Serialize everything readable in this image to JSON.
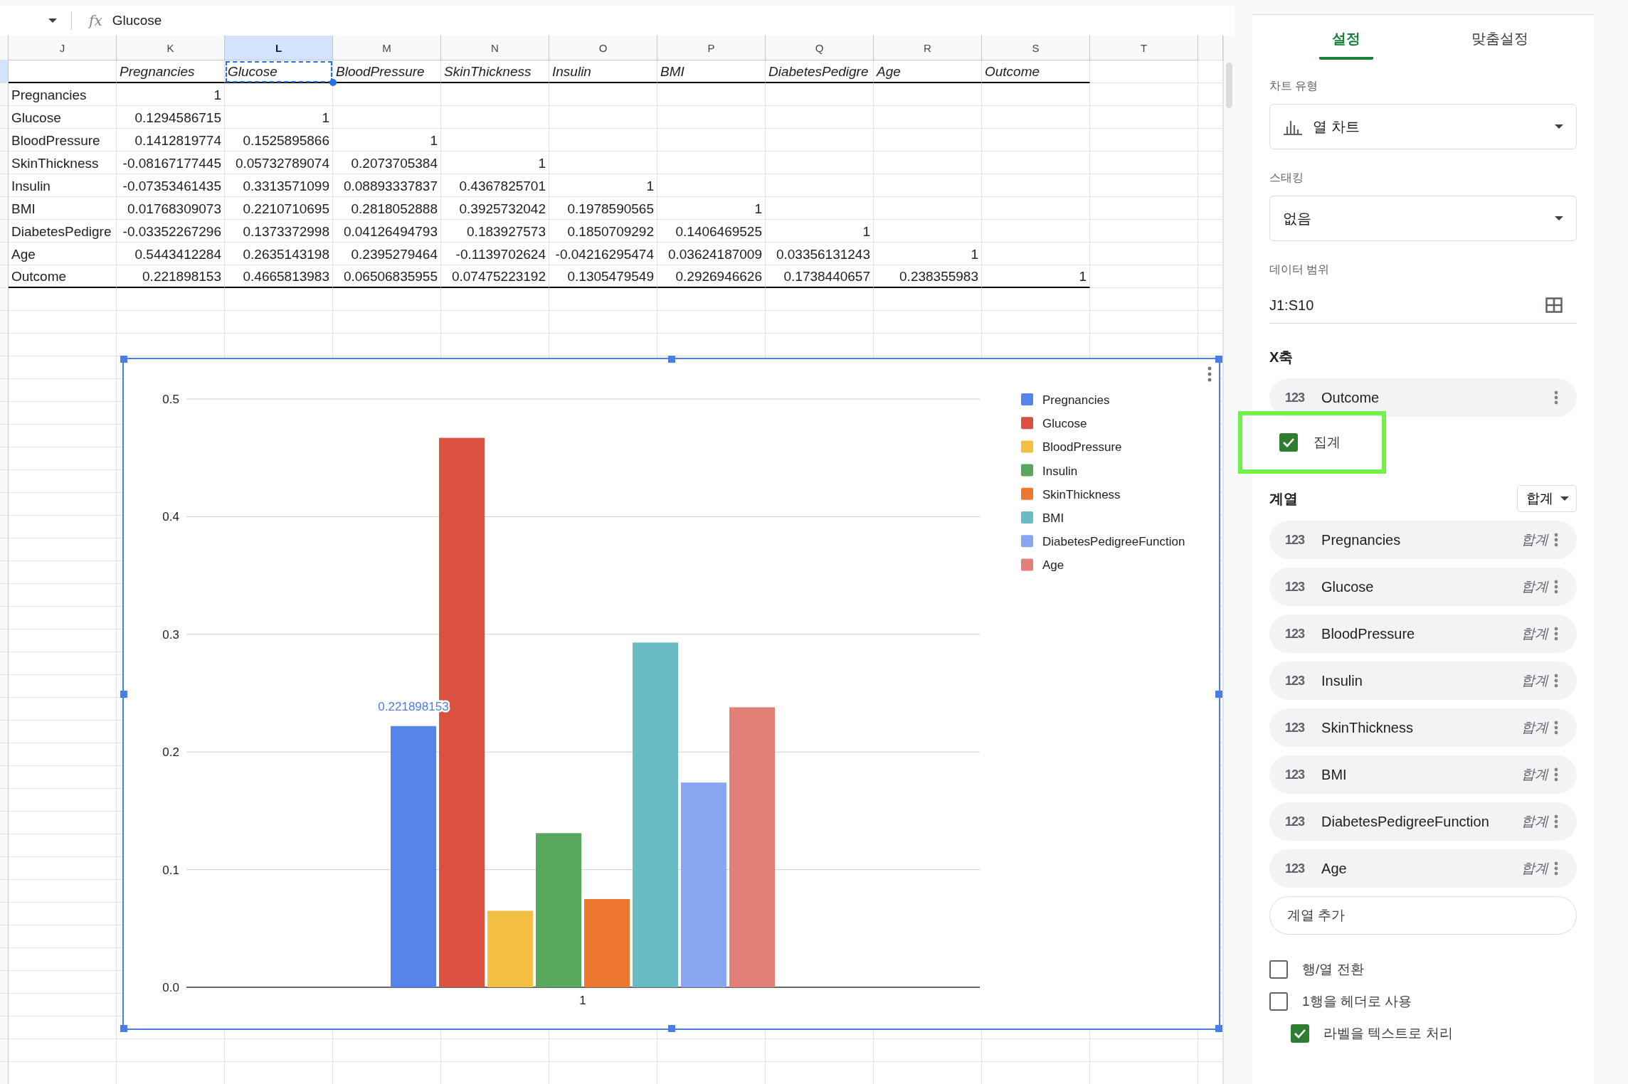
{
  "formula_bar": {
    "fx": "fx",
    "value": "Glucose"
  },
  "sheet": {
    "columns": [
      {
        "label": "J",
        "selected": false
      },
      {
        "label": "K",
        "selected": false
      },
      {
        "label": "L",
        "selected": true
      },
      {
        "label": "M",
        "selected": false
      },
      {
        "label": "N",
        "selected": false
      },
      {
        "label": "O",
        "selected": false
      },
      {
        "label": "P",
        "selected": false
      },
      {
        "label": "Q",
        "selected": false
      },
      {
        "label": "R",
        "selected": false
      },
      {
        "label": "S",
        "selected": false
      },
      {
        "label": "T",
        "selected": false
      }
    ],
    "header_row": [
      {
        "text": "Pregnancies",
        "selected": false
      },
      {
        "text": "Glucose",
        "selected": true
      },
      {
        "text": "BloodPressure",
        "selected": false
      },
      {
        "text": "SkinThickness",
        "selected": false
      },
      {
        "text": "Insulin",
        "selected": false
      },
      {
        "text": "BMI",
        "selected": false
      },
      {
        "text": "DiabetesPedigre",
        "selected": false
      },
      {
        "text": "Age",
        "selected": false
      },
      {
        "text": "Outcome",
        "selected": false
      }
    ],
    "rows": [
      {
        "label": "Pregnancies",
        "values": [
          "1"
        ]
      },
      {
        "label": "Glucose",
        "values": [
          "0.1294586715",
          "1"
        ]
      },
      {
        "label": "BloodPressure",
        "values": [
          "0.1412819774",
          "0.1525895866",
          "1"
        ]
      },
      {
        "label": "SkinThickness",
        "values": [
          "-0.08167177445",
          "0.05732789074",
          "0.2073705384",
          "1"
        ]
      },
      {
        "label": "Insulin",
        "values": [
          "-0.07353461435",
          "0.3313571099",
          "0.08893337837",
          "0.4367825701",
          "1"
        ]
      },
      {
        "label": "BMI",
        "values": [
          "0.01768309073",
          "0.2210710695",
          "0.2818052888",
          "0.3925732042",
          "0.1978590565",
          "1"
        ]
      },
      {
        "label": "DiabetesPedigre",
        "values": [
          "-0.03352267296",
          "0.1373372998",
          "0.04126494793",
          "0.183927573",
          "0.1850709292",
          "0.1406469525",
          "1"
        ]
      },
      {
        "label": "Age",
        "values": [
          "0.5443412284",
          "0.2635143198",
          "0.2395279464",
          "-0.1139702624",
          "-0.04216295474",
          "0.03624187009",
          "0.03356131243",
          "1"
        ]
      },
      {
        "label": "Outcome",
        "values": [
          "0.221898153",
          "0.4665813983",
          "0.06506835955",
          "0.07475223192",
          "0.1305479549",
          "0.2926946626",
          "0.1738440657",
          "0.238355983",
          "1"
        ]
      }
    ]
  },
  "chart": {
    "chart_data": {
      "type": "bar",
      "categories": [
        "1"
      ],
      "series": [
        {
          "name": "Pregnancies",
          "color": "#5585eb",
          "values": [
            0.222
          ]
        },
        {
          "name": "Glucose",
          "color": "#da5140",
          "values": [
            0.467
          ]
        },
        {
          "name": "BloodPressure",
          "color": "#f2bf42",
          "values": [
            0.065
          ]
        },
        {
          "name": "Insulin",
          "color": "#59a75c",
          "values": [
            0.131
          ]
        },
        {
          "name": "SkinThickness",
          "color": "#ed7631",
          "values": [
            0.075
          ]
        },
        {
          "name": "BMI",
          "color": "#69bbc4",
          "values": [
            0.293
          ]
        },
        {
          "name": "DiabetesPedigreeFunction",
          "color": "#87a8f1",
          "values": [
            0.174
          ]
        },
        {
          "name": "Age",
          "color": "#e08076",
          "values": [
            0.238
          ]
        }
      ],
      "grid": true,
      "legend": true,
      "ylim": [
        0,
        0.5
      ],
      "yticks": [
        {
          "value": 0,
          "label": "0.0"
        },
        {
          "value": 0.1,
          "label": "0.1"
        },
        {
          "value": 0.2,
          "label": "0.2"
        },
        {
          "value": 0.3,
          "label": "0.3"
        },
        {
          "value": 0.4,
          "label": "0.4"
        },
        {
          "value": 0.5,
          "label": "0.5"
        }
      ],
      "annotations": [
        "0.221898153"
      ]
    }
  },
  "panel": {
    "tabs": [
      {
        "label": "설정",
        "selected": true
      },
      {
        "label": "맞춤설정",
        "selected": false
      }
    ],
    "chart_type": {
      "label": "차트 유형",
      "value": "열 차트"
    },
    "stacking": {
      "label": "스태킹",
      "value": "없음"
    },
    "data_range": {
      "label": "데이터 범위",
      "value": "J1:S10"
    },
    "x_axis": {
      "title": "X축",
      "field": {
        "badge": "123",
        "name": "Outcome"
      },
      "aggregate": {
        "label": "집계",
        "checked": true,
        "highlighted": true
      }
    },
    "series": {
      "title": "계열",
      "aggregate_menu": "합계",
      "items": [
        {
          "badge": "123",
          "name": "Pregnancies",
          "aggregate": "합계"
        },
        {
          "badge": "123",
          "name": "Glucose",
          "aggregate": "합계"
        },
        {
          "badge": "123",
          "name": "BloodPressure",
          "aggregate": "합계"
        },
        {
          "badge": "123",
          "name": "Insulin",
          "aggregate": "합계"
        },
        {
          "badge": "123",
          "name": "SkinThickness",
          "aggregate": "합계"
        },
        {
          "badge": "123",
          "name": "BMI",
          "aggregate": "합계"
        },
        {
          "badge": "123",
          "name": "DiabetesPedigreeFunction",
          "aggregate": "합계"
        },
        {
          "badge": "123",
          "name": "Age",
          "aggregate": "합계"
        }
      ],
      "add_button": "계열 추가"
    },
    "options": [
      {
        "label": "행/열 전환",
        "checked": false
      },
      {
        "label": "1행을 헤더로 사용",
        "checked": false,
        "children": [
          {
            "label": "라벨을 텍스트로 처리",
            "checked": true
          }
        ]
      }
    ]
  }
}
